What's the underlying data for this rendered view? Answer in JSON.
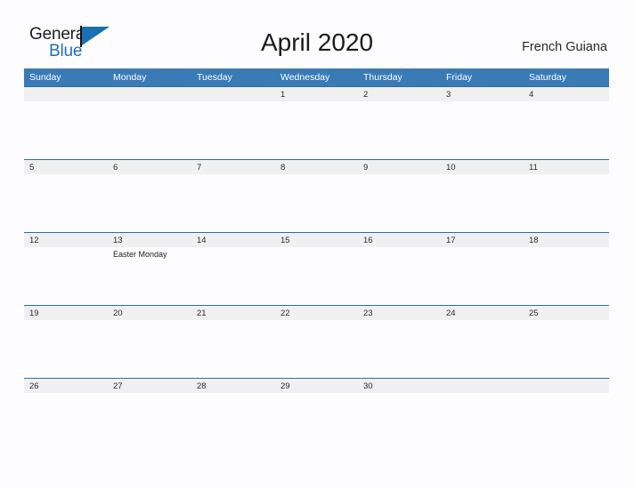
{
  "brand": {
    "word_one": "General",
    "word_two": "Blue",
    "accent_color": "#1a6fb4"
  },
  "header": {
    "title": "April 2020",
    "locale": "French Guiana"
  },
  "colors": {
    "header_blue": "#3a7ab5",
    "rule_blue": "#2e6da4",
    "date_band_gray": "#f0f0f0",
    "page_background": "#fdfdff"
  },
  "calendar": {
    "weekday_headers": [
      "Sunday",
      "Monday",
      "Tuesday",
      "Wednesday",
      "Thursday",
      "Friday",
      "Saturday"
    ],
    "weeks": [
      {
        "days": [
          {
            "date": "",
            "events": []
          },
          {
            "date": "",
            "events": []
          },
          {
            "date": "",
            "events": []
          },
          {
            "date": "1",
            "events": []
          },
          {
            "date": "2",
            "events": []
          },
          {
            "date": "3",
            "events": []
          },
          {
            "date": "4",
            "events": []
          }
        ]
      },
      {
        "days": [
          {
            "date": "5",
            "events": []
          },
          {
            "date": "6",
            "events": []
          },
          {
            "date": "7",
            "events": []
          },
          {
            "date": "8",
            "events": []
          },
          {
            "date": "9",
            "events": []
          },
          {
            "date": "10",
            "events": []
          },
          {
            "date": "11",
            "events": []
          }
        ]
      },
      {
        "days": [
          {
            "date": "12",
            "events": []
          },
          {
            "date": "13",
            "events": [
              "Easter Monday"
            ]
          },
          {
            "date": "14",
            "events": []
          },
          {
            "date": "15",
            "events": []
          },
          {
            "date": "16",
            "events": []
          },
          {
            "date": "17",
            "events": []
          },
          {
            "date": "18",
            "events": []
          }
        ]
      },
      {
        "days": [
          {
            "date": "19",
            "events": []
          },
          {
            "date": "20",
            "events": []
          },
          {
            "date": "21",
            "events": []
          },
          {
            "date": "22",
            "events": []
          },
          {
            "date": "23",
            "events": []
          },
          {
            "date": "24",
            "events": []
          },
          {
            "date": "25",
            "events": []
          }
        ]
      },
      {
        "days": [
          {
            "date": "26",
            "events": []
          },
          {
            "date": "27",
            "events": []
          },
          {
            "date": "28",
            "events": []
          },
          {
            "date": "29",
            "events": []
          },
          {
            "date": "30",
            "events": []
          },
          {
            "date": "",
            "events": []
          },
          {
            "date": "",
            "events": []
          }
        ]
      }
    ]
  }
}
